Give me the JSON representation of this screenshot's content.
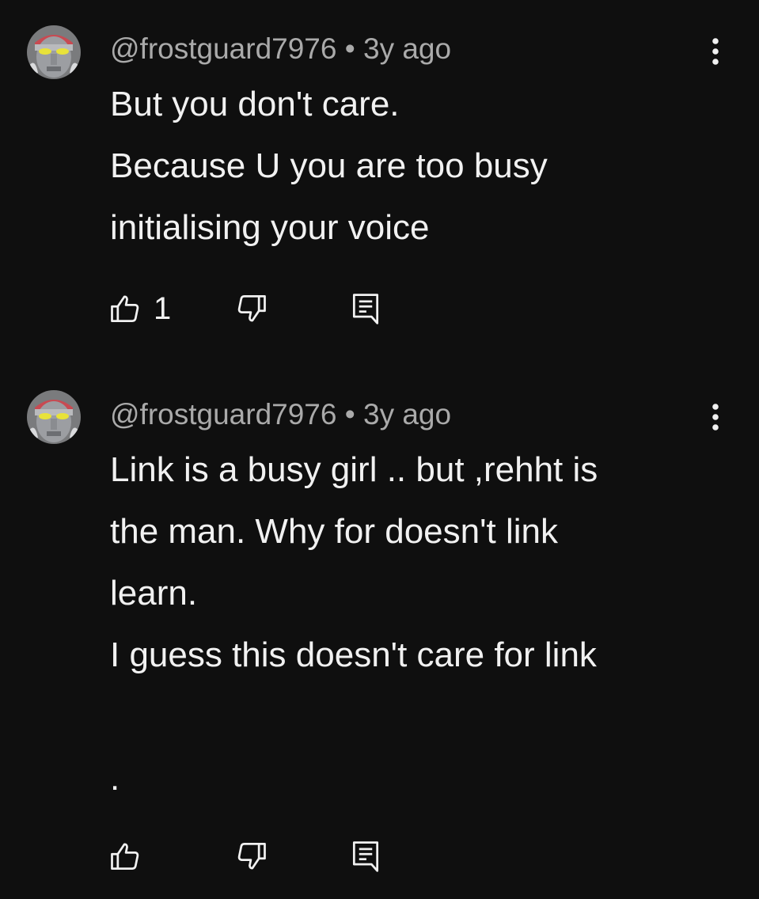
{
  "comments": [
    {
      "author": "@frostguard7976",
      "separator": "•",
      "time": "3y ago",
      "text_lines": [
        "But you don't care.",
        "Because U you are too busy",
        "initialising your voice"
      ],
      "like_count": "1",
      "icons": {
        "more": "more-vert-icon",
        "like": "thumbs-up-icon",
        "dislike": "thumbs-down-icon",
        "reply": "reply-icon"
      }
    },
    {
      "author": "@frostguard7976",
      "separator": "•",
      "time": "3y ago",
      "text_lines": [
        "Link is a busy girl .. but ,rehht is",
        "the man. Why for doesn't link",
        "learn.",
        "I guess this doesn't care for link",
        "",
        "."
      ],
      "like_count": "",
      "icons": {
        "more": "more-vert-icon",
        "like": "thumbs-up-icon",
        "dislike": "thumbs-down-icon",
        "reply": "reply-icon"
      }
    }
  ],
  "colors": {
    "background": "#0f0f0f",
    "primary_text": "#f1f1f1",
    "secondary_text": "#aaaaaa"
  }
}
